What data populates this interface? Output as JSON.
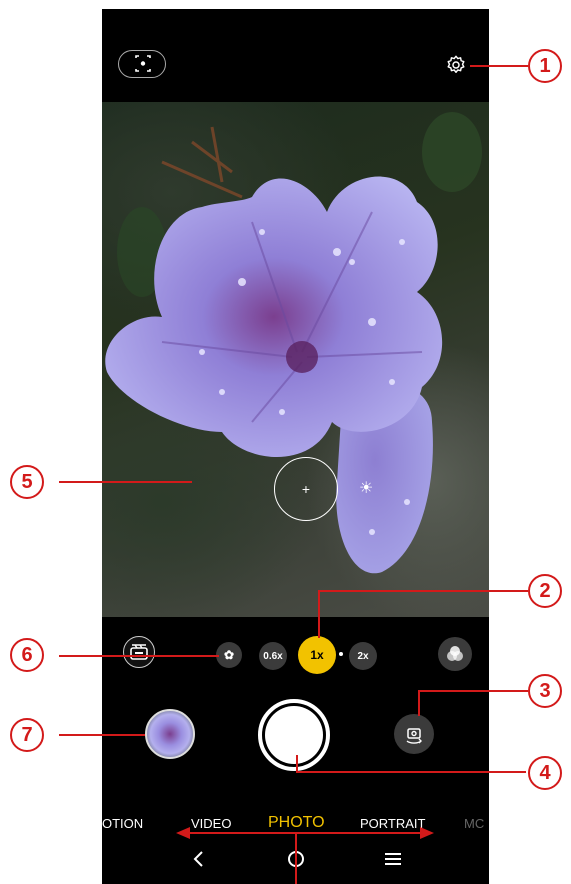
{
  "zoom": {
    "wide": "0.6x",
    "main": "1x",
    "tele": "2x"
  },
  "modes": [
    "OTION",
    "VIDEO",
    "PHOTO",
    "PORTRAIT",
    "MC"
  ],
  "active_mode": "PHOTO",
  "callouts": [
    "1",
    "2",
    "3",
    "4",
    "5",
    "6",
    "7"
  ],
  "icons": {
    "scan": "scan-icon",
    "settings": "gear-icon",
    "mode_select": "video-slate-icon",
    "macro": "flower-icon",
    "filters": "filter-circles-icon",
    "switch_camera": "switch-camera-icon",
    "shutter": "shutter-button",
    "gallery": "gallery-thumbnail",
    "back": "back-chevron-icon",
    "home": "home-circle-icon",
    "recents": "menu-icon"
  },
  "colors": {
    "accent": "#f2c200",
    "callout": "#d31a1a"
  }
}
